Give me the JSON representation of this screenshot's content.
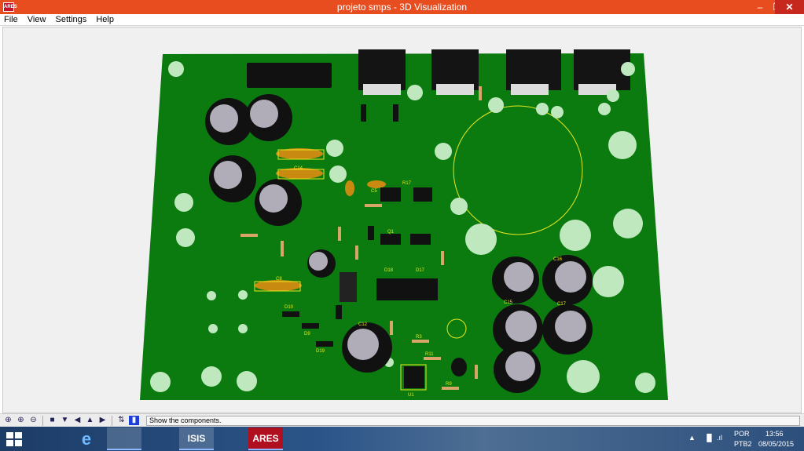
{
  "window": {
    "title": "projeto smps - 3D Visualization",
    "app_icon_text": "ARES",
    "minimize": "–",
    "maximize": "❐",
    "close": "✕"
  },
  "menu": [
    "File",
    "View",
    "Settings",
    "Help"
  ],
  "status": {
    "message": "Show the components.",
    "toolbar_icons": [
      "zoom-extents-icon",
      "zoom-in-icon",
      "zoom-out-icon",
      "view-top-icon",
      "view-front-icon",
      "view-left-icon",
      "view-back-icon",
      "view-right-icon",
      "view-toggle-icon",
      "show-components-icon"
    ]
  },
  "pcb": {
    "board_color": "#0d7a12",
    "silk_color": "#f1f12a",
    "labels": {
      "c14": "C14",
      "c16": "C16",
      "c15": "C15",
      "c17": "C17",
      "c12": "C12",
      "c5": "C5",
      "c8": "C8",
      "r17": "R17",
      "r3": "R3",
      "r11": "R11",
      "r9": "R9",
      "d10": "D10",
      "d9": "D9",
      "d19": "D19",
      "u1": "U1",
      "d18": "D18",
      "d17": "D17",
      "q1": "Q1"
    }
  },
  "taskbar": {
    "apps": [
      {
        "label": "",
        "icon": "file-explorer-icon"
      },
      {
        "label": "e",
        "icon": "internet-explorer-icon"
      },
      {
        "label": "",
        "icon": "folder-icon"
      },
      {
        "label": "",
        "icon": "store-icon"
      },
      {
        "label": "ISIS",
        "icon": "isis-icon"
      },
      {
        "label": "",
        "icon": "chrome-icon"
      },
      {
        "label": "ARES",
        "icon": "ares-icon"
      }
    ],
    "language": "POR",
    "layout": "PTB2",
    "time": "13:56",
    "date": "08/05/2015"
  }
}
